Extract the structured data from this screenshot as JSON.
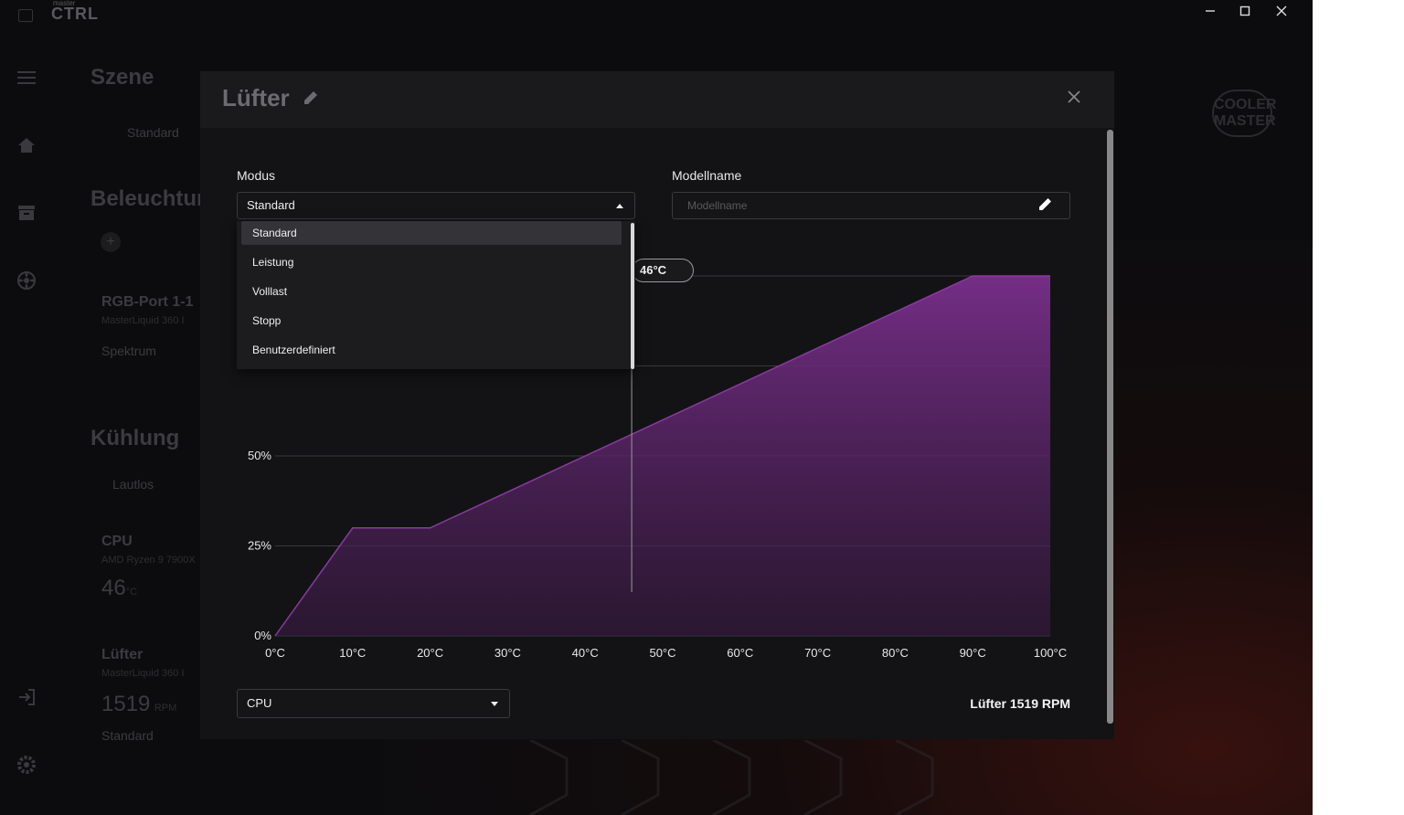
{
  "app": {
    "brand_small": "master",
    "brand": "CTRL"
  },
  "background": {
    "scene_title": "Szene",
    "scene_value": "Standard",
    "lighting_title": "Beleuchtung",
    "rgb_port_title": "RGB-Port 1-1",
    "rgb_port_device": "MasterLiquid 360 I",
    "rgb_port_effect": "Spektrum",
    "cooling_title": "Kühlung",
    "cooling_mode": "Lautlos",
    "cpu_title": "CPU",
    "cpu_model": "AMD Ryzen 9 7900X",
    "cpu_temp": "46",
    "cpu_temp_unit": "°C",
    "fan_title": "Lüfter",
    "fan_device": "MasterLiquid 360 I",
    "fan_rpm": "1519",
    "fan_rpm_unit": "RPM",
    "fan_mode": "Standard",
    "logo_text_1": "COOLER",
    "logo_text_2": "MASTER"
  },
  "modal": {
    "title": "Lüfter",
    "mode_label": "Modus",
    "mode_value": "Standard",
    "model_label": "Modellname",
    "model_placeholder": "Modellname",
    "mode_options": [
      "Standard",
      "Leistung",
      "Volllast",
      "Stopp",
      "Benutzerdefiniert"
    ],
    "sensor_value": "CPU",
    "fan_rpm_text": "Lüfter 1519 RPM",
    "current_temp_label": "46°C"
  },
  "chart_data": {
    "type": "area",
    "x": [
      0,
      10,
      20,
      90,
      100
    ],
    "y": [
      0,
      30,
      30,
      100,
      100
    ],
    "xlim": [
      0,
      100
    ],
    "ylim": [
      0,
      100
    ],
    "x_ticks": [
      "0°C",
      "10°C",
      "20°C",
      "30°C",
      "40°C",
      "50°C",
      "60°C",
      "70°C",
      "80°C",
      "90°C",
      "100°C"
    ],
    "y_ticks": [
      "0%",
      "25%",
      "50%"
    ],
    "y_tick_values": [
      0,
      25,
      50
    ],
    "current_temp": 46,
    "fill_color": "#7a2f8c",
    "grid": true
  },
  "colors": {
    "accent": "#7a2f8c",
    "modal_bg": "#131315"
  }
}
